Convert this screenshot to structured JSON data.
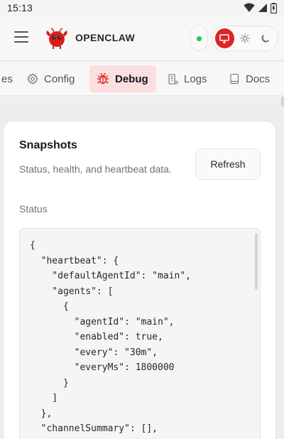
{
  "status_bar": {
    "time": "15:13"
  },
  "app": {
    "brand": "OPENCLAW"
  },
  "tabs": [
    {
      "label": "es",
      "icon": "truncated-tab"
    },
    {
      "label": "Config",
      "icon": "gear-icon"
    },
    {
      "label": "Debug",
      "icon": "bug-icon",
      "active": true
    },
    {
      "label": "Logs",
      "icon": "scroll-icon"
    },
    {
      "label": "Docs",
      "icon": "book-icon"
    }
  ],
  "snapshots": {
    "title": "Snapshots",
    "subtitle": "Status, health, and heartbeat data.",
    "refresh_label": "Refresh",
    "status_label": "Status",
    "status_json": "{\n  \"heartbeat\": {\n    \"defaultAgentId\": \"main\",\n    \"agents\": [\n      {\n        \"agentId\": \"main\",\n        \"enabled\": true,\n        \"every\": \"30m\",\n        \"everyMs\": 1800000\n      }\n    ]\n  },\n  \"channelSummary\": [],"
  },
  "colors": {
    "accent": "#dc2626",
    "active_tab_bg": "#fbdede",
    "online": "#22c55e"
  }
}
